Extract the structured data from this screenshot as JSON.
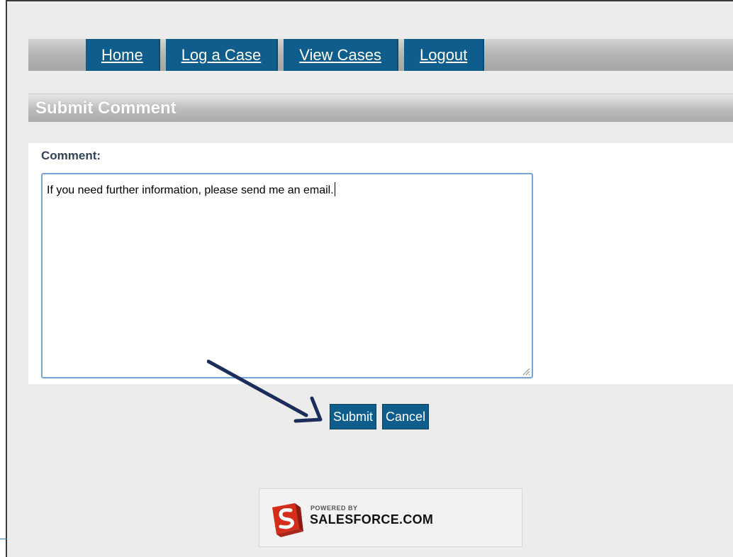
{
  "nav": {
    "tabs": [
      {
        "label": "Home"
      },
      {
        "label": "Log a Case"
      },
      {
        "label": "View Cases"
      },
      {
        "label": "Logout"
      }
    ]
  },
  "section": {
    "title": "Submit Comment"
  },
  "form": {
    "comment_label": "Comment:",
    "comment_value": "If you need further information, please send me an email."
  },
  "actions": {
    "submit_label": "Submit",
    "cancel_label": "Cancel"
  },
  "footer": {
    "powered_by": "POWERED BY",
    "brand": "SALESFORCE.COM"
  },
  "colors": {
    "tab_bg": "#0f5d8c",
    "arrow": "#1b2d5a",
    "logo_red": "#d62c1a"
  },
  "icons": {
    "pointer": "arrow-icon",
    "logo": "salesforce-logo-icon"
  }
}
